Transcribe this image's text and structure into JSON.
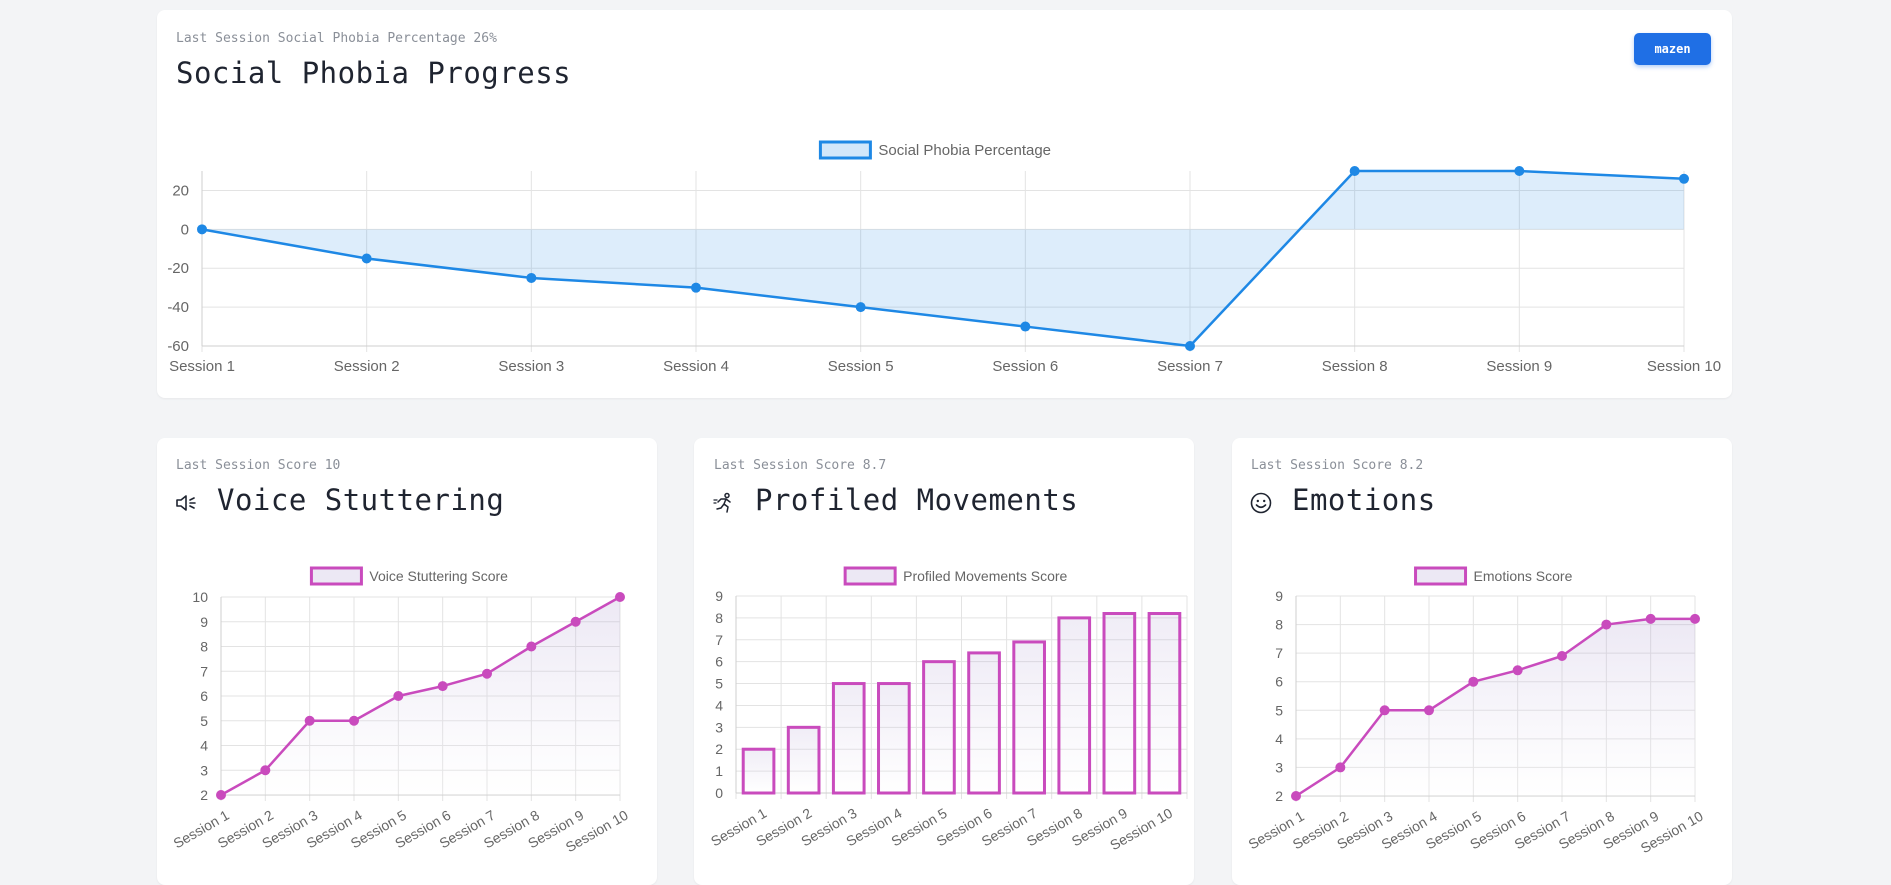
{
  "header": {
    "user_button": "mazen"
  },
  "phobia_card": {
    "subtitle": "Last Session Social Phobia Percentage 26%",
    "title": "Social Phobia Progress"
  },
  "voice_card": {
    "subtitle": "Last Session Score 10",
    "title": "Voice Stuttering",
    "icon": "speaker-icon"
  },
  "movement_card": {
    "subtitle": "Last Session Score 8.7",
    "title": "Profiled Movements",
    "icon": "running-person-icon"
  },
  "emotions_card": {
    "subtitle": "Last Session Score 8.2",
    "title": "Emotions",
    "icon": "smiley-face-icon"
  },
  "colors": {
    "accent_button": "#1f6fe5",
    "phobia_line": "#1e88e5",
    "score_line": "#c94bbd"
  },
  "chart_data": [
    {
      "type": "area",
      "categories": [
        "Session 1",
        "Session 2",
        "Session 3",
        "Session 4",
        "Session 5",
        "Session 6",
        "Session 7",
        "Session 8",
        "Session 9",
        "Session 10"
      ],
      "series": [
        {
          "name": "Social Phobia Percentage",
          "values": [
            0,
            -15,
            -25,
            -30,
            -40,
            -50,
            -60,
            30,
            30,
            26
          ]
        }
      ],
      "yticks": [
        20,
        0,
        -20,
        -40,
        -60
      ],
      "ylim": [
        -60,
        30
      ],
      "grid": true,
      "legend": "top-center",
      "title": "",
      "xlabel": "",
      "ylabel": ""
    },
    {
      "type": "area",
      "categories": [
        "Session 1",
        "Session 2",
        "Session 3",
        "Session 4",
        "Session 5",
        "Session 6",
        "Session 7",
        "Session 8",
        "Session 9",
        "Session 10"
      ],
      "series": [
        {
          "name": "Voice Stuttering Score",
          "values": [
            2,
            3,
            5,
            5,
            6,
            6.4,
            6.9,
            8,
            9,
            10
          ]
        }
      ],
      "yticks": [
        10,
        9,
        8,
        7,
        6,
        5,
        4,
        3,
        2
      ],
      "ylim": [
        2,
        10
      ],
      "grid": true,
      "legend": "top-center",
      "title": "",
      "xlabel": "",
      "ylabel": ""
    },
    {
      "type": "bar",
      "categories": [
        "Session 1",
        "Session 2",
        "Session 3",
        "Session 4",
        "Session 5",
        "Session 6",
        "Session 7",
        "Session 8",
        "Session 9",
        "Session 10"
      ],
      "series": [
        {
          "name": "Profiled Movements Score",
          "values": [
            2,
            3,
            5,
            5,
            6,
            6.4,
            6.9,
            8,
            8.2,
            8.2
          ]
        }
      ],
      "yticks": [
        9,
        8,
        7,
        6,
        5,
        4,
        3,
        2,
        1,
        0
      ],
      "ylim": [
        0,
        9
      ],
      "grid": true,
      "legend": "top-center",
      "title": "",
      "xlabel": "",
      "ylabel": ""
    },
    {
      "type": "area",
      "categories": [
        "Session 1",
        "Session 2",
        "Session 3",
        "Session 4",
        "Session 5",
        "Session 6",
        "Session 7",
        "Session 8",
        "Session 9",
        "Session 10"
      ],
      "series": [
        {
          "name": "Emotions Score",
          "values": [
            2,
            3,
            5,
            5,
            6,
            6.4,
            6.9,
            8,
            8.2,
            8.2
          ]
        }
      ],
      "yticks": [
        9,
        8,
        7,
        6,
        5,
        4,
        3,
        2
      ],
      "ylim": [
        2,
        9
      ],
      "grid": true,
      "legend": "top-center",
      "title": "",
      "xlabel": "",
      "ylabel": ""
    }
  ]
}
